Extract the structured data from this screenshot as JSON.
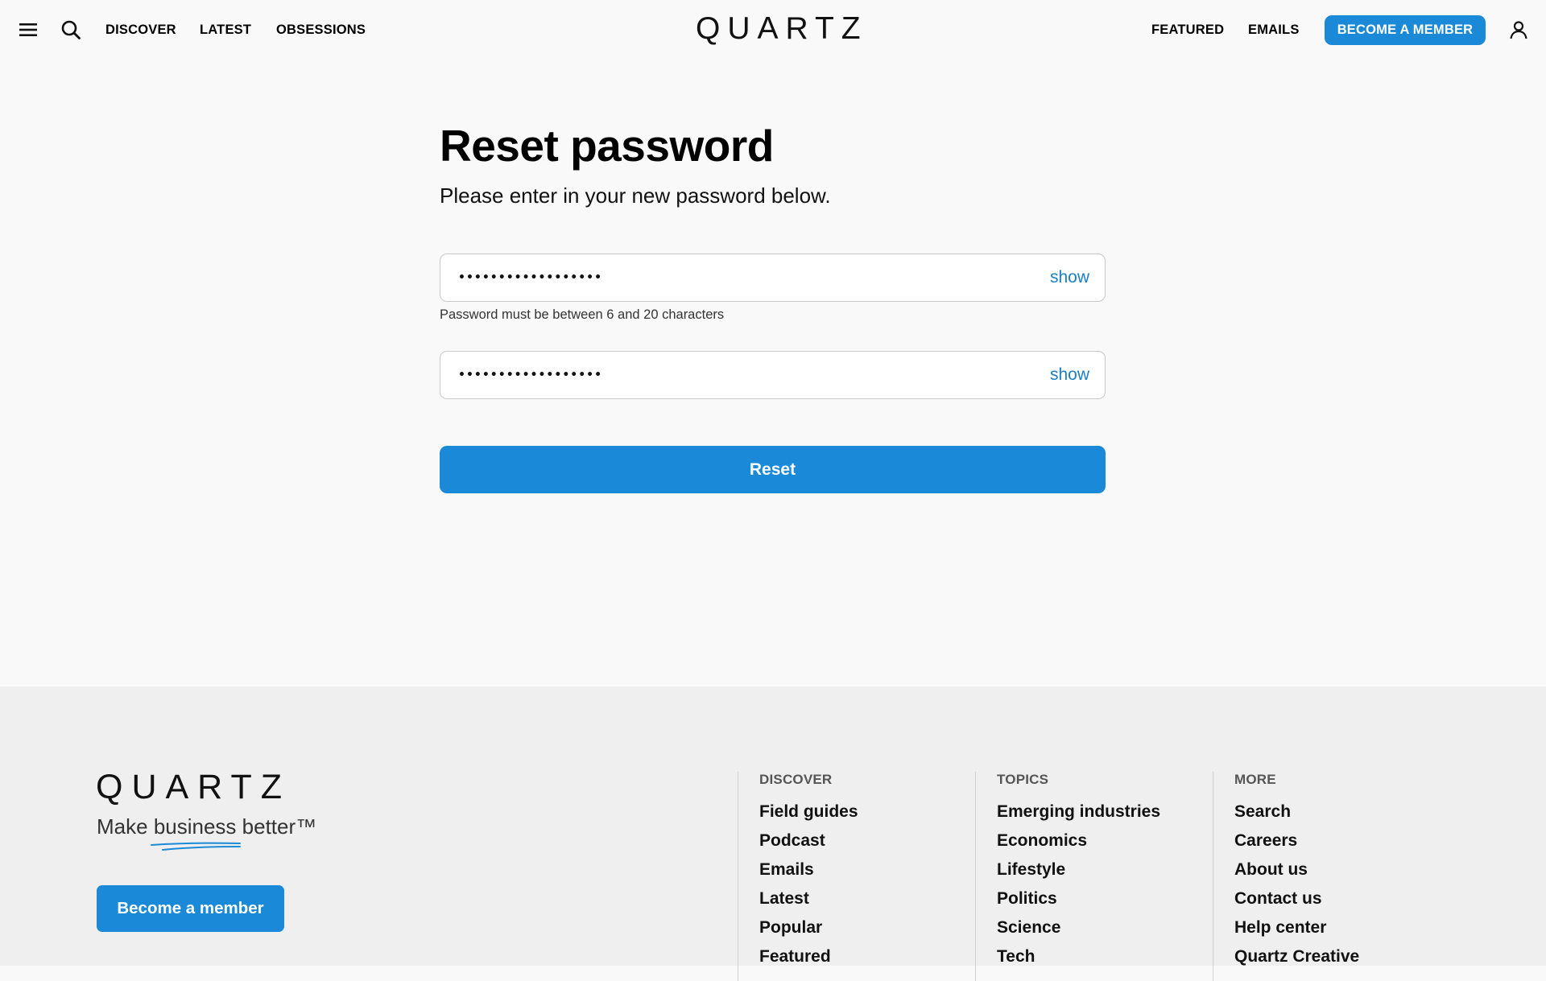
{
  "header": {
    "nav_left": [
      "DISCOVER",
      "LATEST",
      "OBSESSIONS"
    ],
    "logo": "QUARTZ",
    "nav_right": [
      "FEATURED",
      "EMAILS"
    ],
    "member_button": "BECOME A MEMBER",
    "icons": [
      "menu-icon",
      "search-icon",
      "user-icon"
    ]
  },
  "main": {
    "title": "Reset password",
    "subtitle": "Please enter in your new password below.",
    "password_field": {
      "value": "••••••••••••••••••",
      "toggle": "show"
    },
    "password_helper": "Password must be between 6 and 20 characters",
    "confirm_field": {
      "value": "••••••••••••••••••",
      "toggle": "show"
    },
    "reset_button": "Reset"
  },
  "footer": {
    "logo": "QUARTZ",
    "tagline": {
      "before": "Make ",
      "emphasis": "business",
      "after": " better™"
    },
    "member_button": "Become a member",
    "columns": [
      {
        "heading": "DISCOVER",
        "items": [
          "Field guides",
          "Podcast",
          "Emails",
          "Latest",
          "Popular",
          "Featured"
        ]
      },
      {
        "heading": "TOPICS",
        "items": [
          "Emerging industries",
          "Economics",
          "Lifestyle",
          "Politics",
          "Science",
          "Tech"
        ]
      },
      {
        "heading": "MORE",
        "items": [
          "Search",
          "Careers",
          "About us",
          "Contact us",
          "Help center",
          "Quartz Creative"
        ]
      }
    ]
  },
  "colors": {
    "accent": "#1a8ad8",
    "link": "#1a7fc5",
    "page_bg": "#f9f9f9",
    "footer_bg": "#efefef"
  }
}
